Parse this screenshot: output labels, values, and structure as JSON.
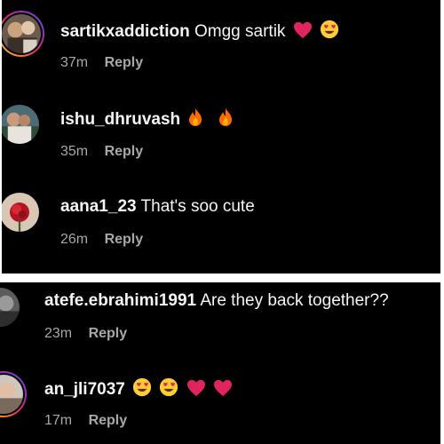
{
  "comments_top": [
    {
      "username": "sartikxaddiction",
      "text": "Omgg sartik",
      "emojis": [
        "red-heart-icon",
        "heart-eyes-emoji-icon"
      ],
      "time": "37m",
      "reply_label": "Reply"
    },
    {
      "username": "ishu_dhruvash",
      "text": "",
      "emojis": [
        "fire-icon",
        "fire-icon"
      ],
      "time": "35m",
      "reply_label": "Reply"
    },
    {
      "username": "aana1_23",
      "text": "That's soo cute",
      "emojis": [],
      "time": "26m",
      "reply_label": "Reply"
    }
  ],
  "comments_bottom": [
    {
      "username": "atefe.ebrahimi1991",
      "text": "Are they back together??",
      "emojis": [],
      "time": "23m",
      "reply_label": "Reply"
    },
    {
      "username": "an_jli7037",
      "text": "",
      "emojis": [
        "heart-eyes-emoji-icon",
        "heart-eyes-emoji-icon",
        "red-heart-icon",
        "red-heart-icon"
      ],
      "time": "17m",
      "reply_label": "Reply"
    }
  ],
  "colors": {
    "background": "#000000",
    "text": "#f5f5f5",
    "meta": "#a8a8a8",
    "heart": "#e0245e",
    "fire": "#ff6a00"
  }
}
